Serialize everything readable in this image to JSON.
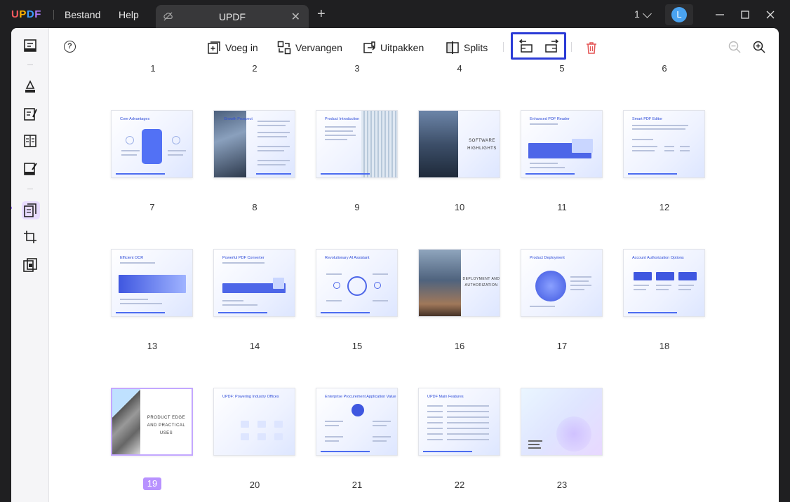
{
  "app": {
    "logo": "UPDF",
    "menus": [
      "Bestand",
      "Help"
    ],
    "tab_label": "UPDF",
    "page_indicator": "1"
  },
  "user": {
    "avatar_initial": "L"
  },
  "toolbar": {
    "insert_label": "Voeg in",
    "replace_label": "Vervangen",
    "extract_label": "Uitpakken",
    "split_label": "Splits"
  },
  "top_row_numbers": [
    "1",
    "2",
    "3",
    "4",
    "5",
    "6"
  ],
  "pages": [
    {
      "num": "7",
      "title": "Core Advantages",
      "layout": "hex"
    },
    {
      "num": "8",
      "title": "Growth Prospect",
      "layout": "photo-left"
    },
    {
      "num": "9",
      "title": "Product Introduction",
      "layout": "glass-right"
    },
    {
      "num": "10",
      "title": "SOFTWARE HIGHLIGHTS",
      "layout": "building-caption"
    },
    {
      "num": "11",
      "title": "Enhanced PDF Reader",
      "layout": "blocks"
    },
    {
      "num": "12",
      "title": "Smart PDF Editor",
      "layout": "text"
    },
    {
      "num": "13",
      "title": "Efficient OCR",
      "layout": "ocr"
    },
    {
      "num": "14",
      "title": "Powerful PDF Converter",
      "layout": "converter"
    },
    {
      "num": "15",
      "title": "Revolutionary AI Assistant",
      "layout": "circle"
    },
    {
      "num": "16",
      "title": "DEPLOYMENT AND AUTHORIZATION",
      "layout": "building-caption"
    },
    {
      "num": "17",
      "title": "Product Deployment",
      "layout": "deploy"
    },
    {
      "num": "18",
      "title": "Account Authorization Options",
      "layout": "arrows"
    },
    {
      "num": "19",
      "title": "PRODUCT EDGE AND PRACTICAL USES",
      "layout": "stairs",
      "selected": true
    },
    {
      "num": "20",
      "title": "UPDF: Powering Industry Offices",
      "layout": "grid"
    },
    {
      "num": "21",
      "title": "Enterprise Procurement Application Value",
      "layout": "hub"
    },
    {
      "num": "22",
      "title": "UPDF Main Features",
      "layout": "table"
    },
    {
      "num": "23",
      "title": "",
      "layout": "blank"
    }
  ],
  "colors": {
    "accent": "#2b3bd6",
    "selection": "#b892ff",
    "brand_blue": "#4c6cf0"
  }
}
